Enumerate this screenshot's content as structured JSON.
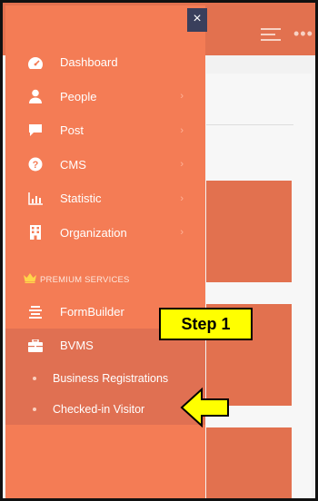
{
  "drawer": {
    "close_glyph": "×",
    "items": [
      {
        "label": "Dashboard",
        "icon": "dashboard-icon",
        "has_children": false
      },
      {
        "label": "People",
        "icon": "person-icon",
        "has_children": true
      },
      {
        "label": "Post",
        "icon": "comment-icon",
        "has_children": true
      },
      {
        "label": "CMS",
        "icon": "question-icon",
        "has_children": true
      },
      {
        "label": "Statistic",
        "icon": "chart-icon",
        "has_children": true
      },
      {
        "label": "Organization",
        "icon": "building-icon",
        "has_children": true
      }
    ],
    "premium_heading": "PREMIUM SERVICES",
    "formbuilder_label": "FormBuilder",
    "bvms_label": "BVMS",
    "bvms_children": [
      "Business Registrations",
      "Checked-in Visitor"
    ]
  },
  "annotation": {
    "step_label": "Step 1"
  },
  "colors": {
    "drawer": "#f47c55",
    "drawer_active": "#e07052",
    "topbar": "#e2714f",
    "highlight": "#ffff00"
  }
}
